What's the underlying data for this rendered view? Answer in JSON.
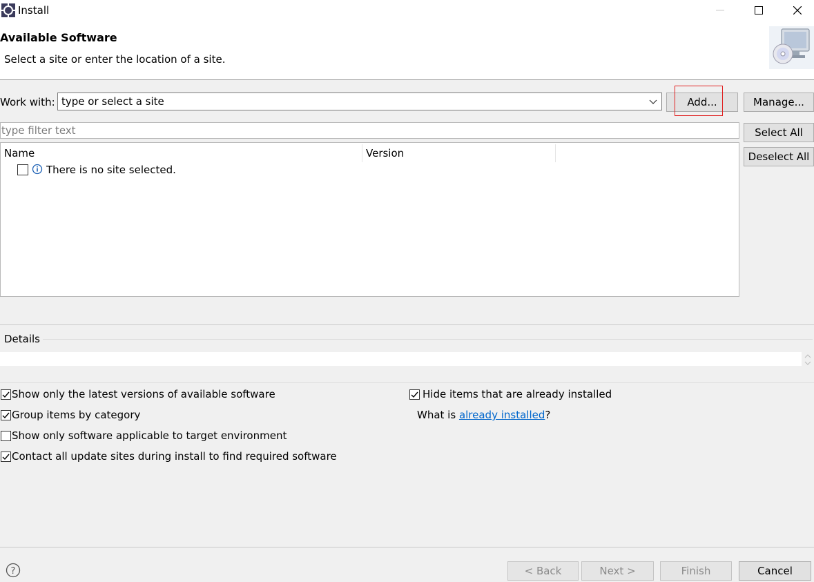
{
  "window": {
    "title": "Install",
    "icon": "eclipse-gear-icon"
  },
  "header": {
    "title": "Available Software",
    "description": "Select a site or enter the location of a site.",
    "image": "install-cd-monitor-icon"
  },
  "work_with": {
    "label": "Work with:",
    "value": "type or select a site",
    "add_label": "Add...",
    "manage_label": "Manage..."
  },
  "filter": {
    "placeholder": "type filter text",
    "select_all_label": "Select All",
    "deselect_all_label": "Deselect All"
  },
  "tree": {
    "columns": [
      "Name",
      "Version"
    ],
    "rows": [
      {
        "checked": false,
        "icon": "info-icon",
        "text": "There is no site selected."
      }
    ]
  },
  "details": {
    "label": "Details"
  },
  "options": {
    "show_latest": {
      "label": "Show only the latest versions of available software",
      "checked": true
    },
    "group_by_category": {
      "label": "Group items by category",
      "checked": true
    },
    "show_applicable": {
      "label": "Show only software applicable to target environment",
      "checked": false
    },
    "contact_sites": {
      "label": "Contact all update sites during install to find required software",
      "checked": true
    },
    "hide_installed": {
      "label": "Hide items that are already installed",
      "checked": true
    },
    "what_is_prefix": "What is ",
    "what_is_link": "already installed",
    "what_is_suffix": "?"
  },
  "footer": {
    "back_label": "< Back",
    "next_label": "Next >",
    "finish_label": "Finish",
    "cancel_label": "Cancel"
  },
  "colors": {
    "highlight": "#e02020",
    "link": "#0066cc",
    "info": "#1a5fb4"
  }
}
